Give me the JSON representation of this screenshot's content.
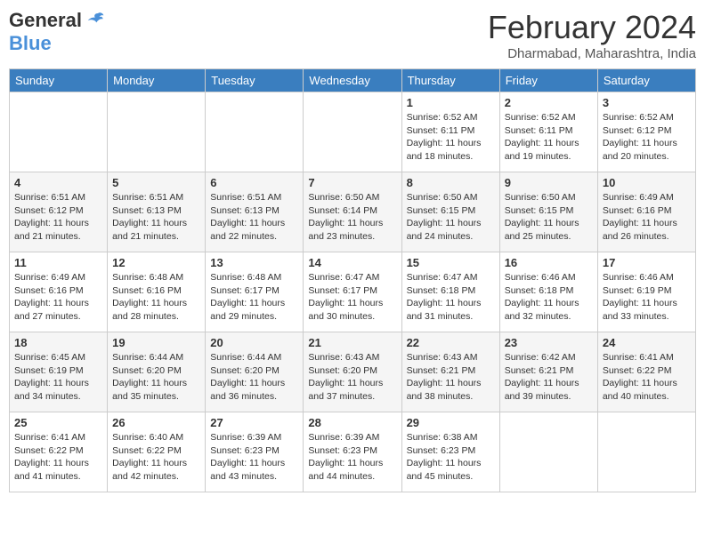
{
  "logo": {
    "general": "General",
    "blue": "Blue"
  },
  "title": "February 2024",
  "subtitle": "Dharmabad, Maharashtra, India",
  "headers": [
    "Sunday",
    "Monday",
    "Tuesday",
    "Wednesday",
    "Thursday",
    "Friday",
    "Saturday"
  ],
  "weeks": [
    [
      {
        "day": "",
        "info": ""
      },
      {
        "day": "",
        "info": ""
      },
      {
        "day": "",
        "info": ""
      },
      {
        "day": "",
        "info": ""
      },
      {
        "day": "1",
        "info": "Sunrise: 6:52 AM\nSunset: 6:11 PM\nDaylight: 11 hours and 18 minutes."
      },
      {
        "day": "2",
        "info": "Sunrise: 6:52 AM\nSunset: 6:11 PM\nDaylight: 11 hours and 19 minutes."
      },
      {
        "day": "3",
        "info": "Sunrise: 6:52 AM\nSunset: 6:12 PM\nDaylight: 11 hours and 20 minutes."
      }
    ],
    [
      {
        "day": "4",
        "info": "Sunrise: 6:51 AM\nSunset: 6:12 PM\nDaylight: 11 hours and 21 minutes."
      },
      {
        "day": "5",
        "info": "Sunrise: 6:51 AM\nSunset: 6:13 PM\nDaylight: 11 hours and 21 minutes."
      },
      {
        "day": "6",
        "info": "Sunrise: 6:51 AM\nSunset: 6:13 PM\nDaylight: 11 hours and 22 minutes."
      },
      {
        "day": "7",
        "info": "Sunrise: 6:50 AM\nSunset: 6:14 PM\nDaylight: 11 hours and 23 minutes."
      },
      {
        "day": "8",
        "info": "Sunrise: 6:50 AM\nSunset: 6:15 PM\nDaylight: 11 hours and 24 minutes."
      },
      {
        "day": "9",
        "info": "Sunrise: 6:50 AM\nSunset: 6:15 PM\nDaylight: 11 hours and 25 minutes."
      },
      {
        "day": "10",
        "info": "Sunrise: 6:49 AM\nSunset: 6:16 PM\nDaylight: 11 hours and 26 minutes."
      }
    ],
    [
      {
        "day": "11",
        "info": "Sunrise: 6:49 AM\nSunset: 6:16 PM\nDaylight: 11 hours and 27 minutes."
      },
      {
        "day": "12",
        "info": "Sunrise: 6:48 AM\nSunset: 6:16 PM\nDaylight: 11 hours and 28 minutes."
      },
      {
        "day": "13",
        "info": "Sunrise: 6:48 AM\nSunset: 6:17 PM\nDaylight: 11 hours and 29 minutes."
      },
      {
        "day": "14",
        "info": "Sunrise: 6:47 AM\nSunset: 6:17 PM\nDaylight: 11 hours and 30 minutes."
      },
      {
        "day": "15",
        "info": "Sunrise: 6:47 AM\nSunset: 6:18 PM\nDaylight: 11 hours and 31 minutes."
      },
      {
        "day": "16",
        "info": "Sunrise: 6:46 AM\nSunset: 6:18 PM\nDaylight: 11 hours and 32 minutes."
      },
      {
        "day": "17",
        "info": "Sunrise: 6:46 AM\nSunset: 6:19 PM\nDaylight: 11 hours and 33 minutes."
      }
    ],
    [
      {
        "day": "18",
        "info": "Sunrise: 6:45 AM\nSunset: 6:19 PM\nDaylight: 11 hours and 34 minutes."
      },
      {
        "day": "19",
        "info": "Sunrise: 6:44 AM\nSunset: 6:20 PM\nDaylight: 11 hours and 35 minutes."
      },
      {
        "day": "20",
        "info": "Sunrise: 6:44 AM\nSunset: 6:20 PM\nDaylight: 11 hours and 36 minutes."
      },
      {
        "day": "21",
        "info": "Sunrise: 6:43 AM\nSunset: 6:20 PM\nDaylight: 11 hours and 37 minutes."
      },
      {
        "day": "22",
        "info": "Sunrise: 6:43 AM\nSunset: 6:21 PM\nDaylight: 11 hours and 38 minutes."
      },
      {
        "day": "23",
        "info": "Sunrise: 6:42 AM\nSunset: 6:21 PM\nDaylight: 11 hours and 39 minutes."
      },
      {
        "day": "24",
        "info": "Sunrise: 6:41 AM\nSunset: 6:22 PM\nDaylight: 11 hours and 40 minutes."
      }
    ],
    [
      {
        "day": "25",
        "info": "Sunrise: 6:41 AM\nSunset: 6:22 PM\nDaylight: 11 hours and 41 minutes."
      },
      {
        "day": "26",
        "info": "Sunrise: 6:40 AM\nSunset: 6:22 PM\nDaylight: 11 hours and 42 minutes."
      },
      {
        "day": "27",
        "info": "Sunrise: 6:39 AM\nSunset: 6:23 PM\nDaylight: 11 hours and 43 minutes."
      },
      {
        "day": "28",
        "info": "Sunrise: 6:39 AM\nSunset: 6:23 PM\nDaylight: 11 hours and 44 minutes."
      },
      {
        "day": "29",
        "info": "Sunrise: 6:38 AM\nSunset: 6:23 PM\nDaylight: 11 hours and 45 minutes."
      },
      {
        "day": "",
        "info": ""
      },
      {
        "day": "",
        "info": ""
      }
    ]
  ]
}
